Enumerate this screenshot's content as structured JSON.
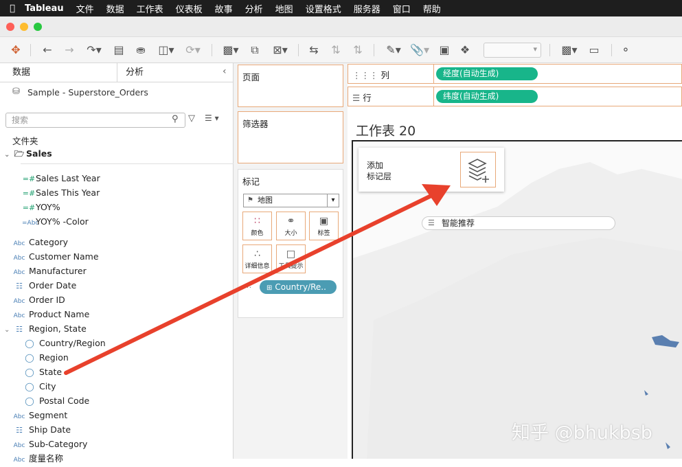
{
  "menubar": {
    "app": "Tableau",
    "items": [
      "文件",
      "数据",
      "工作表",
      "仪表板",
      "故事",
      "分析",
      "地图",
      "设置格式",
      "服务器",
      "窗口",
      "帮助"
    ]
  },
  "datapane": {
    "tab_data": "数据",
    "tab_analysis": "分析",
    "datasource": "Sample - Superstore_Orders",
    "search_placeholder": "搜索",
    "folder_header": "文件夹",
    "folder_sales": "Sales",
    "sales_fields": [
      "Sales Last  Year",
      "Sales This Year",
      "YOY%",
      "YOY% -Color"
    ],
    "fields": {
      "category": "Category",
      "customer_name": "Customer Name",
      "manufacturer": "Manufacturer",
      "order_date": "Order Date",
      "order_id": "Order ID",
      "product_name": "Product Name",
      "region_state": "Region, State",
      "country_region": "Country/Region",
      "region": "Region",
      "state": "State",
      "city": "City",
      "postal_code": "Postal Code",
      "segment": "Segment",
      "ship_date": "Ship Date",
      "sub_category": "Sub-Category",
      "measure_names": "度量名称"
    }
  },
  "cards": {
    "pages": "页面",
    "filters": "筛选器",
    "marks": "标记",
    "mark_type": "地图",
    "color": "颜色",
    "size": "大小",
    "label": "标签",
    "detail": "详细信息",
    "tooltip": "工具提示",
    "detail_pill": "Country/Re.."
  },
  "shelves": {
    "columns_label": "列",
    "columns_pill": "经度(自动生成)",
    "rows_label": "行",
    "rows_pill": "纬度(自动生成)"
  },
  "canvas": {
    "sheet_title": "工作表 20",
    "add_layer_line1": "添加",
    "add_layer_line2": "标记层",
    "smart_recommend": "智能推荐"
  },
  "watermark": "知乎 @bhukbsb",
  "colors": {
    "accent_orange": "#e8a878",
    "pill_green": "#18b58a",
    "pill_teal": "#4b9cb3",
    "arrow_red": "#e8412c"
  }
}
